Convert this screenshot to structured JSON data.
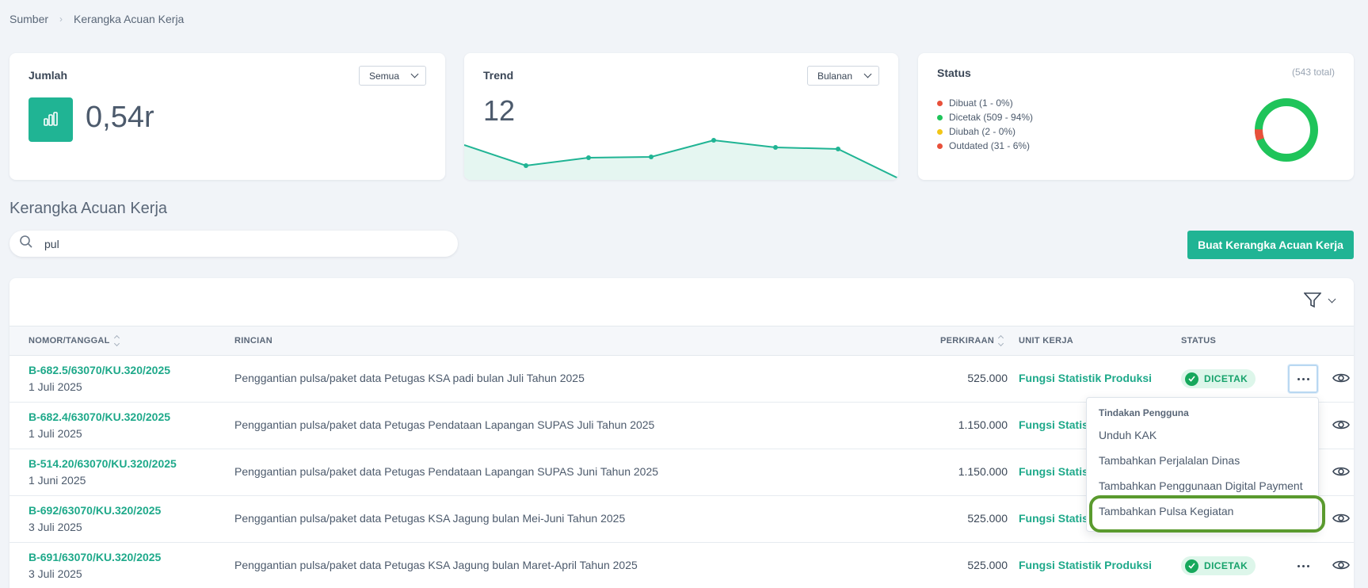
{
  "breadcrumb": {
    "root": "Sumber",
    "current": "Kerangka Acuan Kerja"
  },
  "cards": {
    "jumlah": {
      "title": "Jumlah",
      "filter": "Semua",
      "value": "0,54r"
    },
    "trend": {
      "title": "Trend",
      "filter": "Bulanan",
      "value": "12"
    },
    "status": {
      "title": "Status",
      "total": "(543 total)",
      "legend": [
        {
          "label": "Dibuat (1 - 0%)",
          "color": "#e8503a",
          "count": 1
        },
        {
          "label": "Dicetak (509 - 94%)",
          "color": "#1fc45a",
          "count": 509
        },
        {
          "label": "Diubah (2 - 0%)",
          "color": "#f2c617",
          "count": 2
        },
        {
          "label": "Outdated (31 - 6%)",
          "color": "#e8503a",
          "count": 31
        }
      ]
    }
  },
  "section_title": "Kerangka Acuan Kerja",
  "search": {
    "value": "pul",
    "placeholder": ""
  },
  "create_button": "Buat Kerangka Acuan Kerja",
  "table": {
    "headers": {
      "nomor": "NOMOR/TANGGAL",
      "rincian": "RINCIAN",
      "perkiraan": "PERKIRAAN",
      "unit": "UNIT KERJA",
      "status": "STATUS"
    },
    "rows": [
      {
        "nomor": "B-682.5/63070/KU.320/2025",
        "tanggal": "1 Juli 2025",
        "rincian": "Penggantian pulsa/paket data Petugas KSA padi bulan Juli Tahun 2025",
        "perkiraan": "525.000",
        "unit": "Fungsi Statistik Produksi",
        "status": "DICETAK"
      },
      {
        "nomor": "B-682.4/63070/KU.320/2025",
        "tanggal": "1 Juli 2025",
        "rincian": "Penggantian pulsa/paket data Petugas Pendataan Lapangan SUPAS Juli Tahun 2025",
        "perkiraan": "1.150.000",
        "unit": "Fungsi Statis",
        "status": ""
      },
      {
        "nomor": "B-514.20/63070/KU.320/2025",
        "tanggal": "1 Juni 2025",
        "rincian": "Penggantian pulsa/paket data Petugas Pendataan Lapangan SUPAS Juni Tahun 2025",
        "perkiraan": "1.150.000",
        "unit": "Fungsi Statis",
        "status": ""
      },
      {
        "nomor": "B-692/63070/KU.320/2025",
        "tanggal": "3 Juli 2025",
        "rincian": "Penggantian pulsa/paket data Petugas KSA Jagung bulan Mei-Juni Tahun 2025",
        "perkiraan": "525.000",
        "unit": "Fungsi Statis",
        "status": ""
      },
      {
        "nomor": "B-691/63070/KU.320/2025",
        "tanggal": "3 Juli 2025",
        "rincian": "Penggantian pulsa/paket data Petugas KSA Jagung bulan Maret-April Tahun 2025",
        "perkiraan": "525.000",
        "unit": "Fungsi Statistik Produksi",
        "status": "DICETAK"
      }
    ]
  },
  "dropdown": {
    "header": "Tindakan Pengguna",
    "items": [
      "Unduh KAK",
      "Tambahkan Perjalalan Dinas",
      "Tambahkan Penggunaan Digital Payment",
      "Tambahkan Pulsa Kegiatan"
    ]
  },
  "colors": {
    "accent": "#20b494",
    "link": "#1ea98a",
    "highlight": "#5a9a2e"
  }
}
